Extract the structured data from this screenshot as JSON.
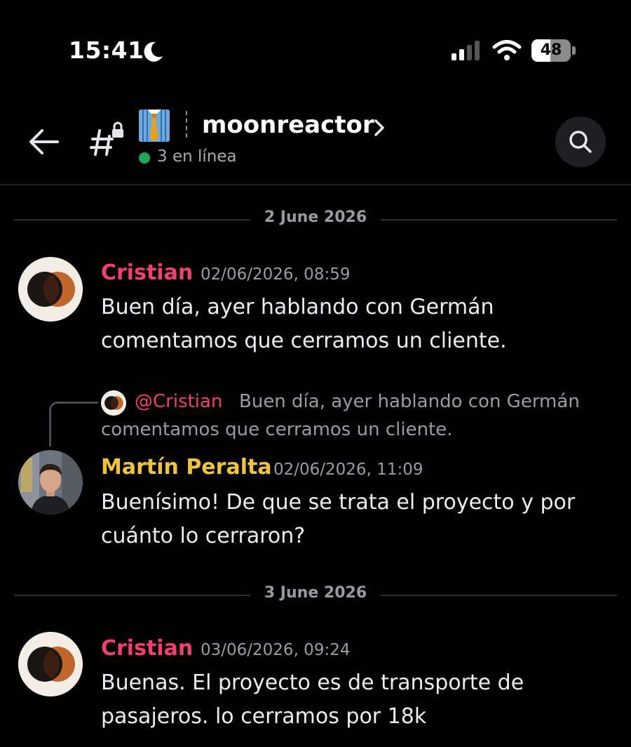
{
  "status_bar": {
    "time": "15:41",
    "battery_level": "48",
    "battery_fraction": 0.48,
    "icons": [
      "moon-icon",
      "cellular-signal-icon",
      "wifi-icon",
      "battery-icon"
    ]
  },
  "header": {
    "server_name": "moonreactor",
    "online_count_text": "3 en línea",
    "icons": [
      "back-arrow-icon",
      "locked-channel-icon",
      "necktie-emoji",
      "chevron-right-icon",
      "search-icon"
    ],
    "colors": {
      "online": "#23a55a"
    }
  },
  "dates": [
    "2 June 2026",
    "3 June 2026"
  ],
  "messages": [
    {
      "author": "Cristian",
      "timestamp": "02/06/2026, 08:59",
      "lines": [
        "Buen día, ayer hablando con Germán",
        "comentamos que cerramos un cliente."
      ],
      "author_color": "#f23f6f"
    },
    {
      "reply_to": {
        "mention": "@Cristian",
        "text_line1": "Buen día, ayer hablando con Germán",
        "text_line2": "comentamos que cerramos un cliente."
      },
      "author": "Martín Peralta",
      "timestamp": "02/06/2026, 11:09",
      "lines": [
        "Buenísimo! De que se trata el proyecto y por",
        "cuánto lo cerraron?"
      ],
      "author_color": "#f0c43a"
    },
    {
      "author": "Cristian",
      "timestamp": "03/06/2026, 09:24",
      "lines": [
        "Buenas. El proyecto es de transporte de",
        "pasajeros. lo cerramos por 18k"
      ],
      "author_color": "#f23f6f"
    }
  ]
}
